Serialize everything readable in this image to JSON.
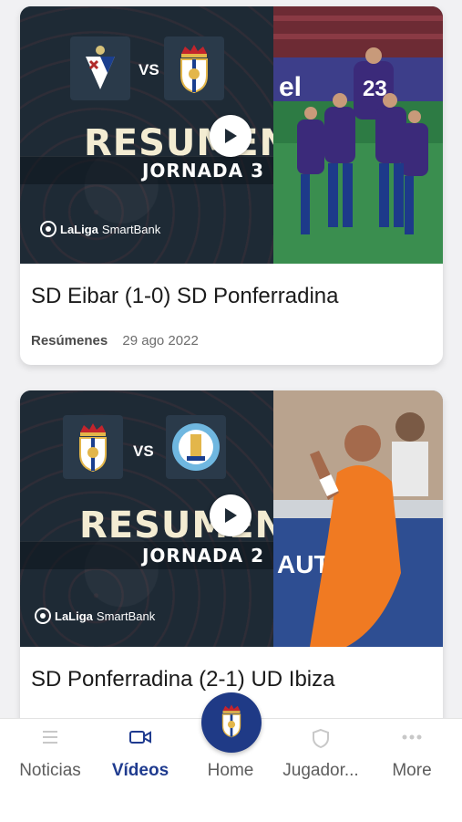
{
  "feed": {
    "videos": [
      {
        "thumbnail": {
          "home_team": "SD Eibar",
          "away_team": "SD Ponferradina",
          "vs": "VS",
          "resumen": "RESUMEN",
          "jornada": "JORNADA 3",
          "brand": "LaLiga",
          "brand_sub": "SmartBank",
          "photo_number": "23"
        },
        "title": "SD Eibar (1-0) SD Ponferradina",
        "category": "Resúmenes",
        "date": "29 ago 2022"
      },
      {
        "thumbnail": {
          "home_team": "SD Ponferradina",
          "away_team": "UD Ibiza",
          "vs": "VS",
          "resumen": "RESUMEN",
          "jornada": "JORNADA 2",
          "brand": "LaLiga",
          "brand_sub": "SmartBank"
        },
        "title": "SD Ponferradina (2-1) UD Ibiza"
      }
    ]
  },
  "bottom_nav": {
    "items": [
      {
        "label": "Noticias",
        "icon": "news-list-icon",
        "active": false
      },
      {
        "label": "Vídeos",
        "icon": "video-camera-icon",
        "active": true
      },
      {
        "label": "Home",
        "icon": "club-crest-icon",
        "active": false
      },
      {
        "label": "Jugador...",
        "icon": "shield-icon",
        "active": false
      },
      {
        "label": "More",
        "icon": "more-dots-icon",
        "active": false
      }
    ]
  },
  "colors": {
    "accent": "#1f3b8f",
    "thumb_dark": "#1e2a35",
    "resumen_text": "#f3ecd2"
  }
}
